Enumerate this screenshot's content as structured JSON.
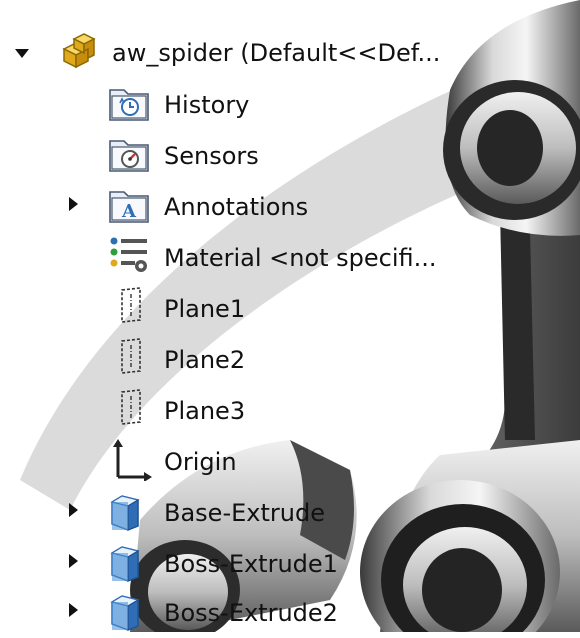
{
  "feature_tree": {
    "root": {
      "label": "aw_spider  (Default<<Def...",
      "icon": "part-icon",
      "expanded": true
    },
    "items": [
      {
        "label": "History",
        "icon": "history-folder-icon",
        "expandable": false
      },
      {
        "label": "Sensors",
        "icon": "sensors-folder-icon",
        "expandable": false
      },
      {
        "label": "Annotations",
        "icon": "annotations-folder-icon",
        "expandable": true
      },
      {
        "label": "Material <not specifi...",
        "icon": "material-icon",
        "expandable": false
      },
      {
        "label": "Plane1",
        "icon": "plane-icon",
        "expandable": false
      },
      {
        "label": "Plane2",
        "icon": "plane-icon",
        "expandable": false
      },
      {
        "label": "Plane3",
        "icon": "plane-icon",
        "expandable": false
      },
      {
        "label": "Origin",
        "icon": "origin-icon",
        "expandable": false
      },
      {
        "label": "Base-Extrude",
        "icon": "extrude-feature-icon",
        "expandable": true
      },
      {
        "label": "Boss-Extrude1",
        "icon": "extrude-feature-icon",
        "expandable": true
      },
      {
        "label": "Boss-Extrude2",
        "icon": "extrude-feature-icon",
        "expandable": true
      }
    ]
  },
  "colors": {
    "background": "#ffffff",
    "text": "#111111",
    "accent_part": "#f2c230",
    "folder_blue": "#2f6db5"
  }
}
